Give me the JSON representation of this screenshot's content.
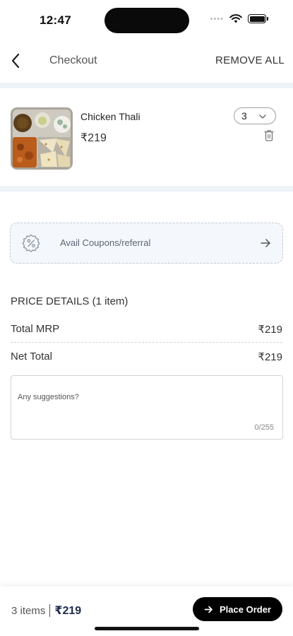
{
  "status_bar": {
    "time": "12:47",
    "signal_icon": "cellular-dots-icon",
    "wifi_icon": "wifi-icon",
    "battery_icon": "battery-icon",
    "battery_level": 1.0
  },
  "header": {
    "back_icon": "chevron-left-icon",
    "title": "Checkout",
    "remove_all_label": "REMOVE ALL"
  },
  "cart": {
    "items": [
      {
        "name": "Chicken Thali",
        "price": "₹219",
        "quantity": "3",
        "image": "chicken-thali-photo",
        "delete_icon": "trash-icon",
        "dropdown_icon": "chevron-down-icon"
      }
    ]
  },
  "coupon": {
    "icon": "percent-badge-icon",
    "label": "Avail Coupons/referral",
    "arrow_icon": "arrow-right-icon"
  },
  "price_details": {
    "heading": "PRICE DETAILS (1 item)",
    "rows": [
      {
        "label": "Total MRP",
        "value": "₹219"
      },
      {
        "label": "Net Total",
        "value": "₹219"
      }
    ]
  },
  "suggestions": {
    "placeholder": "Any suggestions?",
    "value": "",
    "counter": "0/255"
  },
  "bottom_bar": {
    "items_count": "3 items",
    "total": "₹219",
    "place_order_label": "Place Order",
    "place_order_icon": "arrow-right-icon"
  },
  "colors": {
    "accent": "#000000",
    "section_band": "#eef3f8",
    "coupon_bg": "#f4f7fb",
    "total_text": "#1c2a4a"
  }
}
